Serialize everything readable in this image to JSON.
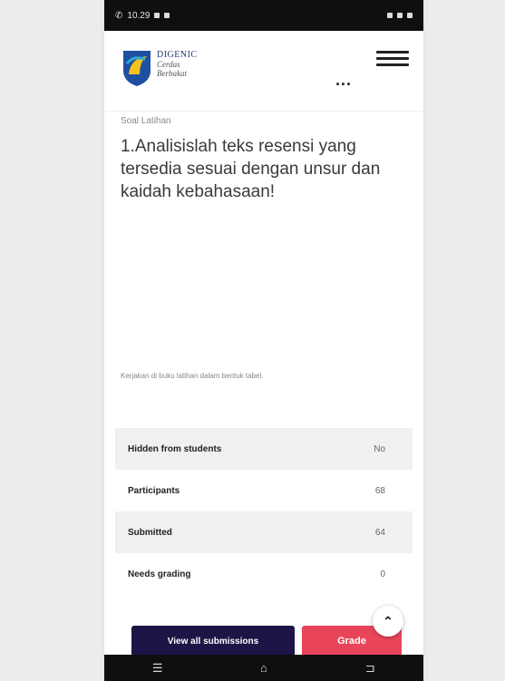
{
  "statusbar": {
    "time": "10.29"
  },
  "header": {
    "brand_line1": "DIGENIC",
    "brand_line2": "Cerdas",
    "brand_line3": "Berbakat",
    "more_label": "..."
  },
  "content": {
    "section_label": "Soal Latihan",
    "question": "1.Analisislah teks resensi yang tersedia sesuai dengan unsur dan kaidah kebahasaan!",
    "note": "Kerjakan di buku latihan dalam bentuk tabel."
  },
  "summary_table": [
    {
      "key": "Hidden from students",
      "value": "No"
    },
    {
      "key": "Participants",
      "value": "68"
    },
    {
      "key": "Submitted",
      "value": "64"
    },
    {
      "key": "Needs grading",
      "value": "0"
    }
  ],
  "actions": {
    "view_all": "View all submissions",
    "grade": "Grade"
  },
  "icons": {
    "menu": "hamburger-menu-icon",
    "scroll_top": "chevron-up-icon",
    "nav_menu": "recent-apps-icon",
    "nav_home": "home-icon",
    "nav_back": "back-icon"
  }
}
